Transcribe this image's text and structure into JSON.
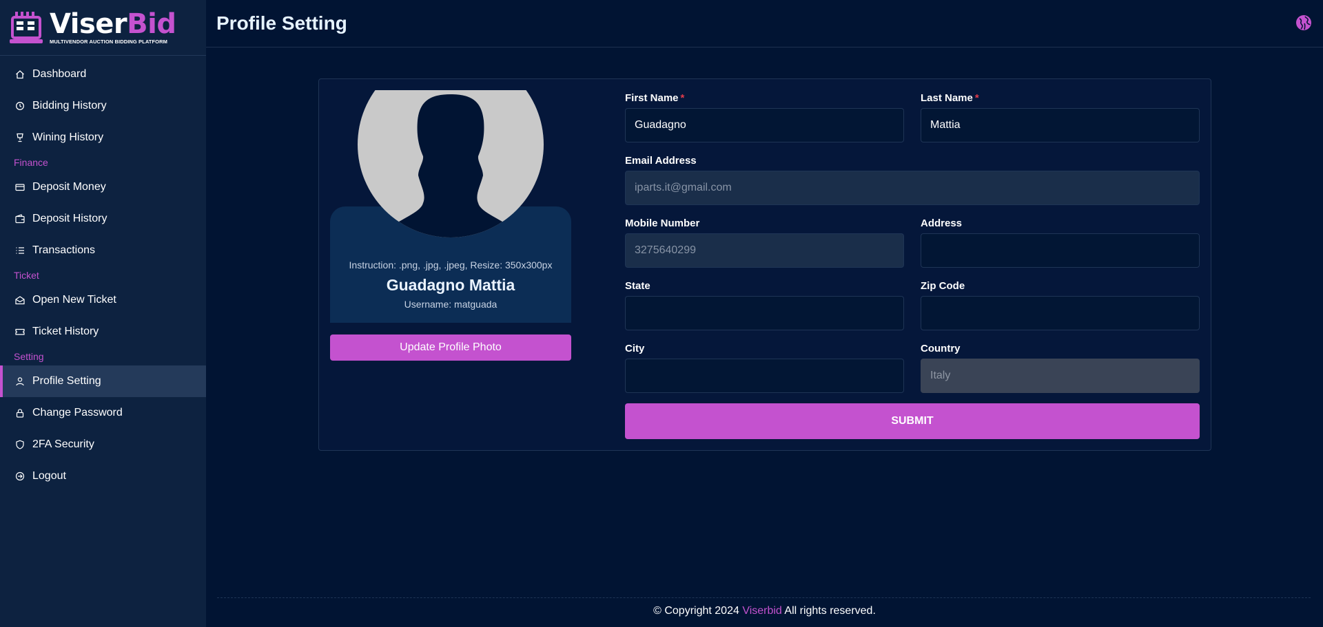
{
  "brand": {
    "name_part1": "Viser",
    "name_part2": "Bid",
    "tagline": "MULTIVENDOR AUCTION BIDDING PLATFORM",
    "accent_color": "#c452cf"
  },
  "sidebar": {
    "items": [
      {
        "label": "Dashboard",
        "icon": "home-icon"
      },
      {
        "label": "Bidding History",
        "icon": "history-icon"
      },
      {
        "label": "Wining History",
        "icon": "trophy-icon"
      }
    ],
    "finance_label": "Finance",
    "finance_items": [
      {
        "label": "Deposit Money",
        "icon": "credit-card-icon"
      },
      {
        "label": "Deposit History",
        "icon": "wallet-icon"
      },
      {
        "label": "Transactions",
        "icon": "list-icon"
      }
    ],
    "ticket_label": "Ticket",
    "ticket_items": [
      {
        "label": "Open New Ticket",
        "icon": "envelope-open-icon"
      },
      {
        "label": "Ticket History",
        "icon": "ticket-icon"
      }
    ],
    "setting_label": "Setting",
    "setting_items": [
      {
        "label": "Profile Setting",
        "icon": "user-icon",
        "active": true
      },
      {
        "label": "Change Password",
        "icon": "lock-icon"
      },
      {
        "label": "2FA Security",
        "icon": "shield-icon"
      },
      {
        "label": "Logout",
        "icon": "logout-icon"
      }
    ]
  },
  "header": {
    "title": "Profile Setting",
    "language_icon": "globe-icon"
  },
  "profile": {
    "instruction": "Instruction: .png, .jpg, .jpeg, Resize: 350x300px",
    "name": "Guadagno Mattia",
    "username": "Username: matguada",
    "upload_label": "Update Profile Photo"
  },
  "form": {
    "first_name": {
      "label": "First Name",
      "value": "Guadagno",
      "required_mark": "*"
    },
    "last_name": {
      "label": "Last Name",
      "value": "Mattia",
      "required_mark": "*"
    },
    "email": {
      "label": "Email Address",
      "value": "iparts.it@gmail.com"
    },
    "mobile": {
      "label": "Mobile Number",
      "value": "3275640299"
    },
    "address": {
      "label": "Address",
      "value": ""
    },
    "state": {
      "label": "State",
      "value": ""
    },
    "zip": {
      "label": "Zip Code",
      "value": ""
    },
    "city": {
      "label": "City",
      "value": ""
    },
    "country": {
      "label": "Country",
      "value": "Italy"
    },
    "submit_label": "SUBMIT"
  },
  "footer": {
    "prefix": "© Copyright 2024",
    "brand": "Viserbid",
    "suffix": "All rights reserved."
  }
}
